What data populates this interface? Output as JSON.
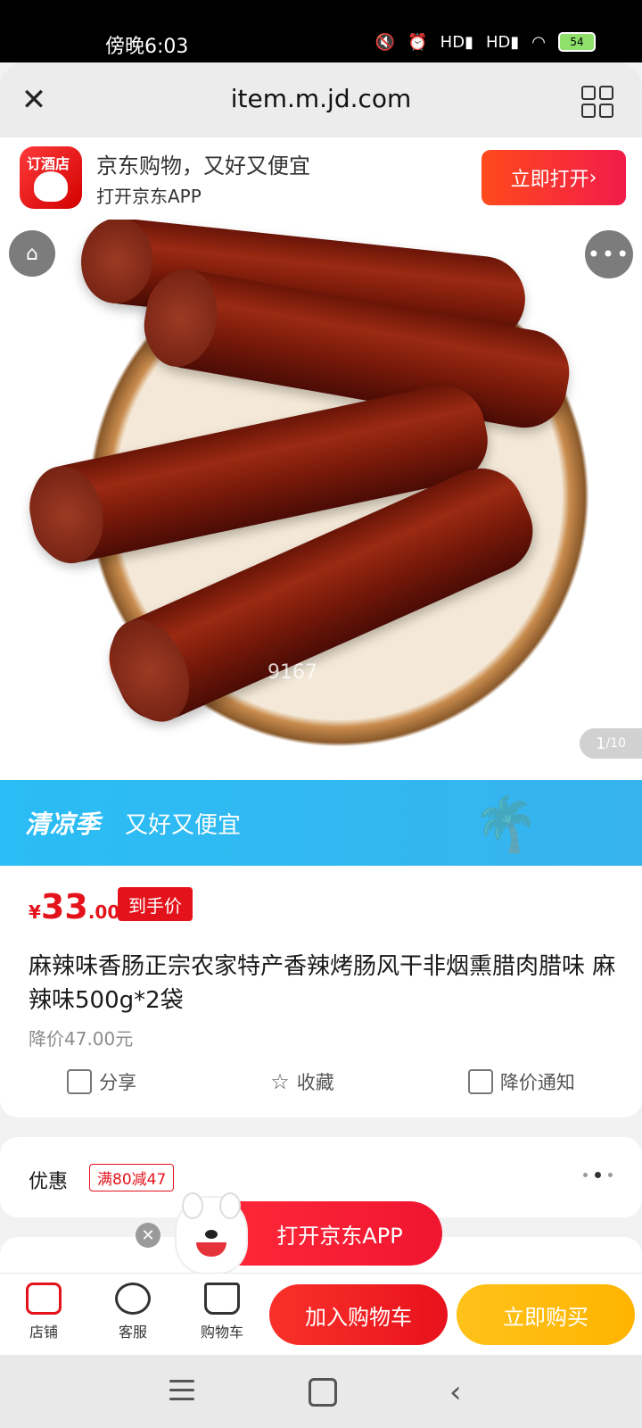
{
  "status_bar": {
    "time": "傍晚6:03",
    "battery": "54",
    "net1": "HD",
    "net2": "HD"
  },
  "browser": {
    "url": "item.m.jd.com"
  },
  "app_banner": {
    "logo_text": "订酒店",
    "title": "京东购物，又好又便宜",
    "subtitle": "打开京东APP",
    "open_label": "立即打开"
  },
  "product_image": {
    "watermark": "9167",
    "counter_current": "1",
    "counter_total": "/10"
  },
  "season_banner": {
    "bold": "清凉季",
    "text": "又好又便宜"
  },
  "product": {
    "currency": "¥",
    "price_int": "33",
    "price_dec": ".00",
    "price_tag": "到手价",
    "title": "麻辣味香肠正宗农家特产香辣烤肠风干非烟熏腊肉腊味 麻辣味500g*2袋",
    "price_drop": "降价47.00元",
    "actions": {
      "share": "分享",
      "favorite": "收藏",
      "notify": "降价通知"
    }
  },
  "promo": {
    "label": "优惠",
    "tag": "满80减47"
  },
  "float_app": {
    "label": "打开京东APP"
  },
  "bottom_bar": {
    "store": "店铺",
    "service": "客服",
    "cart": "购物车",
    "add_cart": "加入购物车",
    "buy_now": "立即购买"
  },
  "colors": {
    "jd_red": "#e4131b",
    "season_blue": "#2bbdf5",
    "buy_yellow": "#ffb400"
  }
}
